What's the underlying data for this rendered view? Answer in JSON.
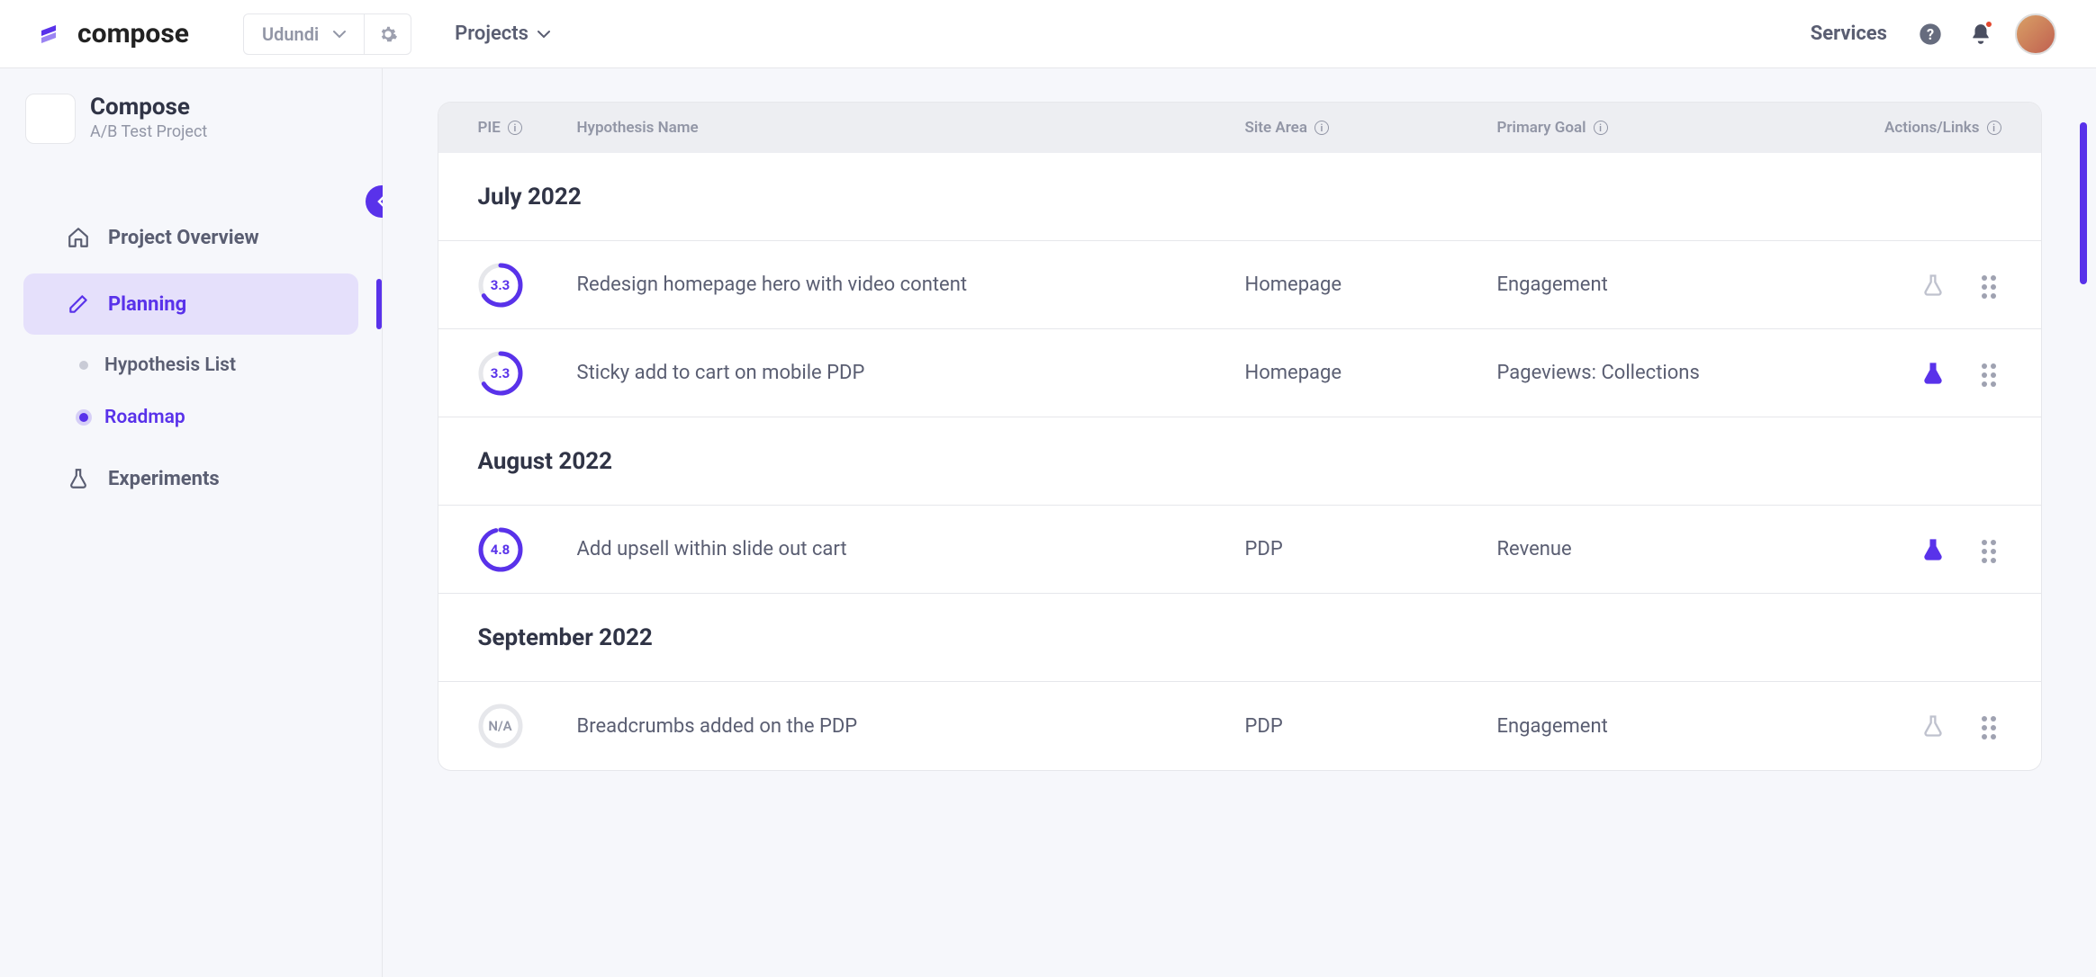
{
  "topbar": {
    "brand": "compose",
    "org": "Udundi",
    "nav_projects": "Projects",
    "services": "Services"
  },
  "sidebar": {
    "project_title": "Compose",
    "project_sub": "A/B Test Project",
    "items": {
      "overview": "Project Overview",
      "planning": "Planning",
      "hypothesis": "Hypothesis List",
      "roadmap": "Roadmap",
      "experiments": "Experiments"
    }
  },
  "table": {
    "headers": {
      "pie": "PIE",
      "name": "Hypothesis Name",
      "area": "Site Area",
      "goal": "Primary Goal",
      "actions": "Actions/Links"
    },
    "months": {
      "m1": "July 2022",
      "m2": "August 2022",
      "m3": "September 2022"
    },
    "rows": {
      "r1": {
        "pie": "3.3",
        "pct": 66,
        "name": "Redesign homepage hero with video content",
        "area": "Homepage",
        "goal": "Engagement",
        "flask": "outline"
      },
      "r2": {
        "pie": "3.3",
        "pct": 66,
        "name": "Sticky add to cart on mobile PDP",
        "area": "Homepage",
        "goal": "Pageviews: Collections",
        "flask": "filled"
      },
      "r3": {
        "pie": "4.8",
        "pct": 96,
        "name": "Add upsell within slide out cart",
        "area": "PDP",
        "goal": "Revenue",
        "flask": "filled"
      },
      "r4": {
        "pie": "N/A",
        "pct": 0,
        "name": "Breadcrumbs added on the PDP",
        "area": "PDP",
        "goal": "Engagement",
        "flask": "outline"
      }
    }
  }
}
